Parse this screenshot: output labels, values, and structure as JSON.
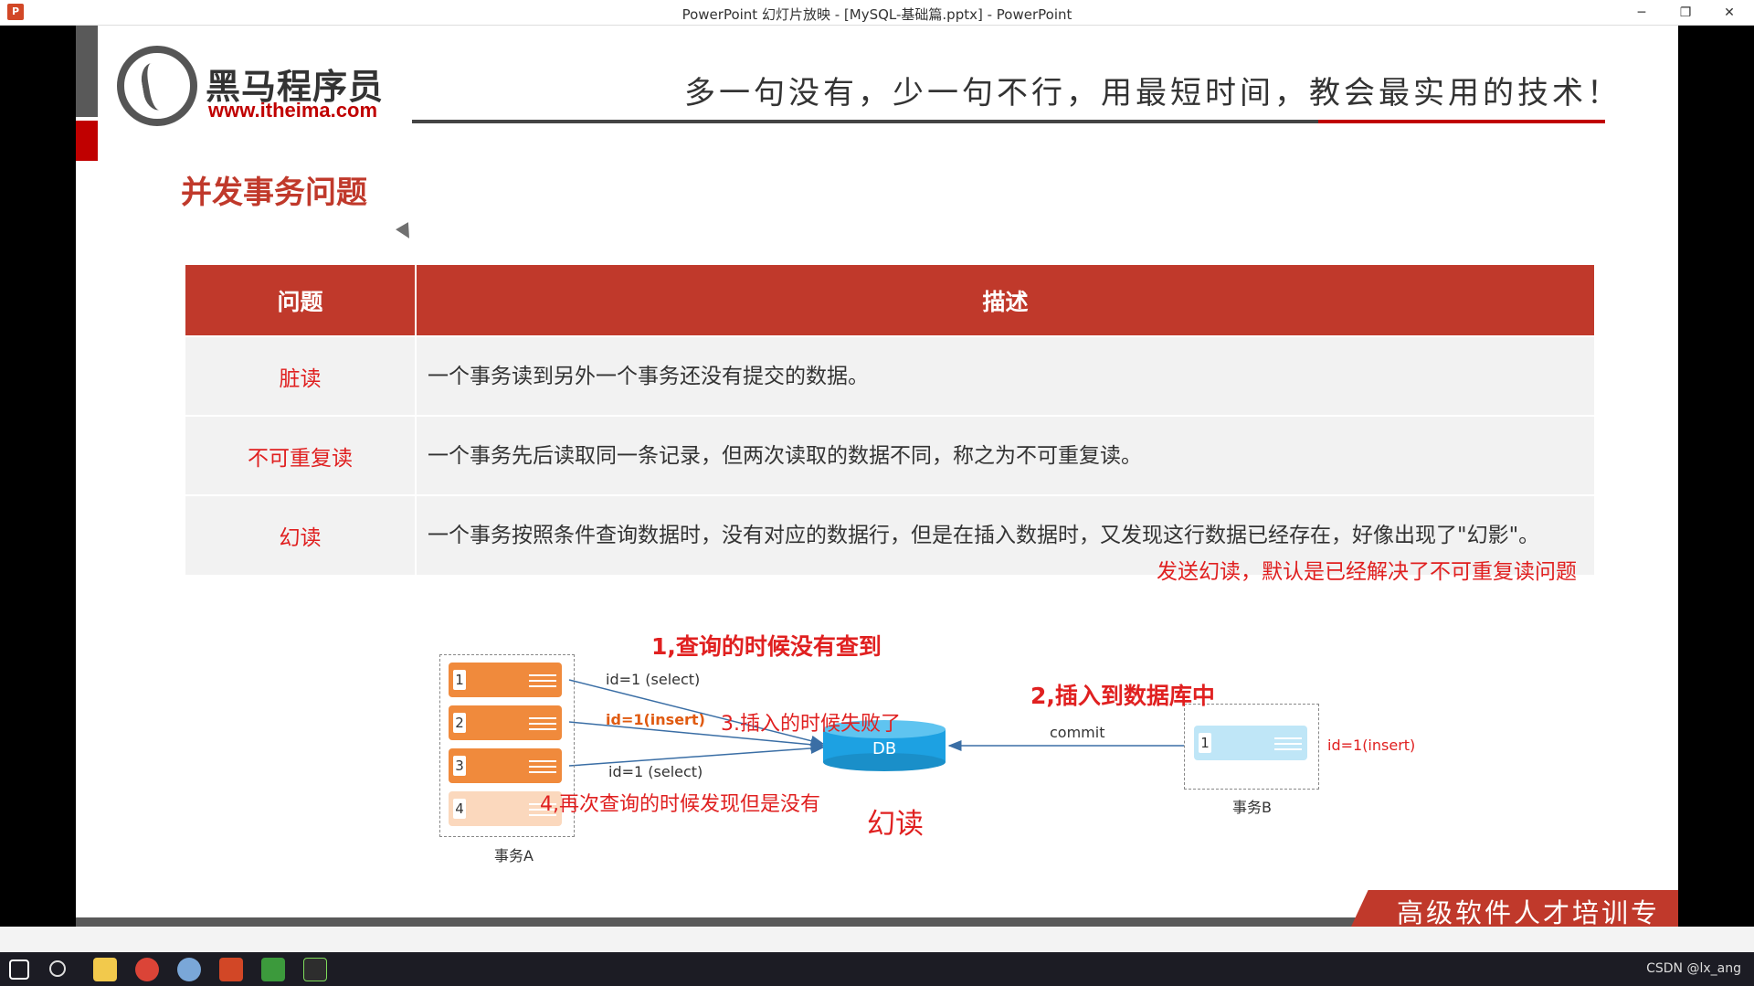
{
  "window": {
    "title": "PowerPoint 幻灯片放映 - [MySQL-基础篇.pptx] - PowerPoint",
    "app_icon": "P",
    "minimize": "─",
    "restore": "❐",
    "close": "✕"
  },
  "header": {
    "logo_cn": "黑马程序员",
    "logo_url": "www.itheima.com",
    "slogan": "多一句没有，少一句不行，用最短时间，教会最实用的技术！"
  },
  "slide_title": "并发事务问题",
  "table": {
    "headers": [
      "问题",
      "描述"
    ],
    "rows": [
      {
        "problem": "脏读",
        "description": "一个事务读到另外一个事务还没有提交的数据。"
      },
      {
        "problem": "不可重复读",
        "description": "一个事务先后读取同一条记录，但两次读取的数据不同，称之为不可重复读。"
      },
      {
        "problem": "幻读",
        "description": "一个事务按照条件查询数据时，没有对应的数据行，但是在插入数据时，又发现这行数据已经存在，好像出现了\"幻影\"。"
      }
    ]
  },
  "note": "发送幻读，默认是已经解决了不可重复读问题",
  "diagram": {
    "annotation_1": "1,查询的时候没有查到",
    "annotation_2": "2,插入到数据库中",
    "annotation_3": "3.插入的时候失败了",
    "annotation_4": "4,再次查询的时候发现但是没有",
    "phantom_label": "幻读",
    "tx_a_rows": [
      "1",
      "2",
      "3",
      "4"
    ],
    "tx_a_label": "事务A",
    "tx_b_row": "1",
    "tx_b_label": "事务B",
    "edge_select_1": "id=1 (select)",
    "edge_insert": "id=1(insert)",
    "edge_select_2": "id=1 (select)",
    "commit": "commit",
    "tx_b_insert": "id=1(insert)",
    "db_label": "DB"
  },
  "footer": {
    "banner": "高级软件人才培训专家"
  },
  "taskbar": {
    "tray_text": "CSDN @lx_ang"
  },
  "colors": {
    "accent_red": "#c0392b",
    "annotation_red": "#e02020",
    "orange": "#f08a3c",
    "light_blue": "#bfe6f7",
    "db_blue": "#1da1e2"
  }
}
